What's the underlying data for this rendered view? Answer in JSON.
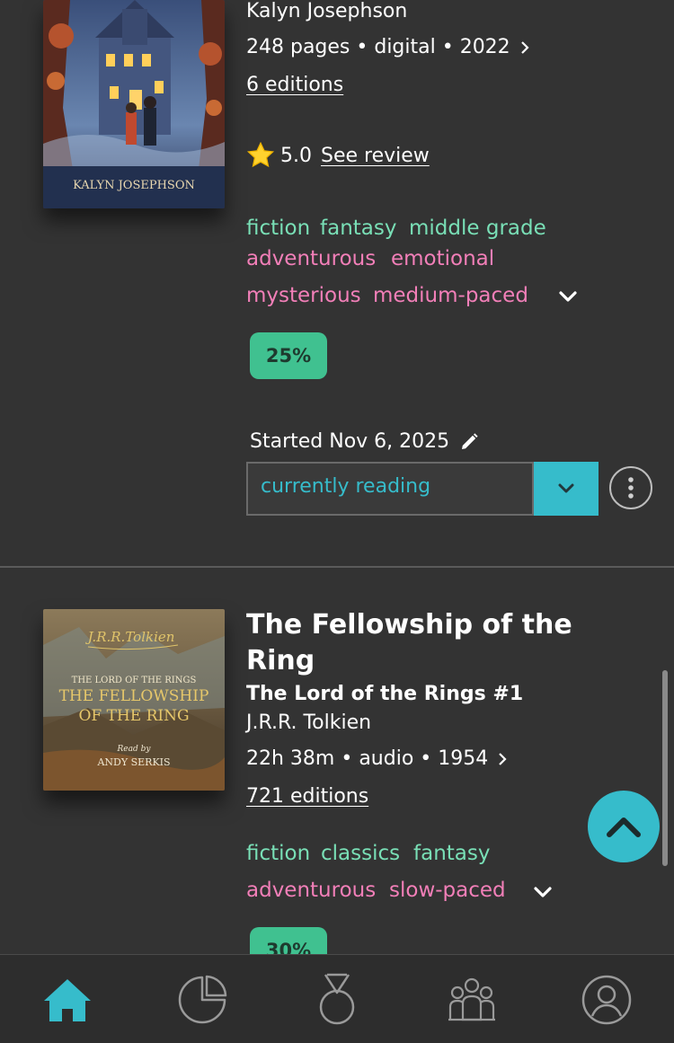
{
  "book1": {
    "cover_author": "KALYN JOSEPHSON",
    "author": "Kalyn Josephson",
    "meta": "248 pages • digital • 2022",
    "editions": "6 editions",
    "rating": "5.0",
    "see_review": "See review",
    "genre_tags": [
      "fiction",
      "fantasy",
      "middle grade"
    ],
    "mood_tags_line1": [
      "adventurous",
      "emotional"
    ],
    "mood_tags_line2": [
      "mysterious",
      "medium-paced"
    ],
    "progress": "25%",
    "started": "Started Nov 6, 2025",
    "status": "currently reading"
  },
  "book2": {
    "title_line1": "The Fellowship of the",
    "title_line2": "Ring",
    "series": "The Lord of the Rings #1",
    "author": "J.R.R. Tolkien",
    "meta": "22h 38m • audio • 1954",
    "editions": "721 editions",
    "genre_tags": [
      "fiction",
      "classics",
      "fantasy"
    ],
    "mood_tags": [
      "adventurous",
      "slow-paced"
    ],
    "progress": "30%",
    "cover": {
      "signature": "J.R.R.Tolkien",
      "series": "THE LORD OF THE RINGS",
      "title_line1": "THE FELLOWSHIP",
      "title_line2": "OF THE RING",
      "read_by": "Read by",
      "narrator": "ANDY SERKIS"
    }
  },
  "nav": {
    "items": [
      "home-icon",
      "stats-icon",
      "challenges-icon",
      "community-icon",
      "profile-icon"
    ],
    "active": "home-icon"
  },
  "colors": {
    "accent": "#36bccb",
    "genre": "#79dfb6",
    "mood": "#f27fb8",
    "progress": "#40c190",
    "background": "#333333"
  }
}
